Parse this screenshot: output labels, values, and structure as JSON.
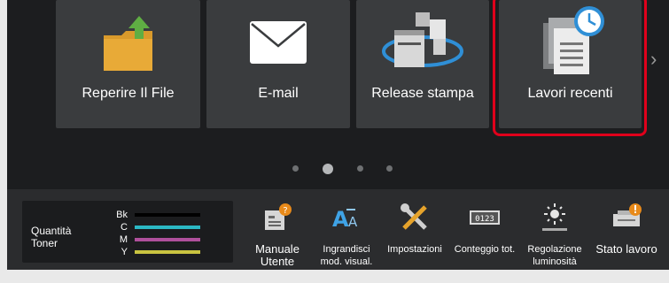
{
  "tiles": [
    {
      "label": "Reperire Il File",
      "icon": "folder-upload-icon"
    },
    {
      "label": "E-mail",
      "icon": "envelope-icon"
    },
    {
      "label": "Release stampa",
      "icon": "printer-network-icon"
    },
    {
      "label": "Lavori recenti",
      "icon": "recent-jobs-clock-icon"
    }
  ],
  "next_arrow": "›",
  "pager": {
    "pages": 4,
    "current": 2
  },
  "toner": {
    "title": "Quantità Toner",
    "levels": [
      {
        "name": "Bk",
        "color": "#000000"
      },
      {
        "name": "C",
        "color": "#2bb8c4"
      },
      {
        "name": "M",
        "color": "#b0509c"
      },
      {
        "name": "Y",
        "color": "#c9c340"
      }
    ]
  },
  "bottom_buttons": [
    {
      "label": "Manuale Utente",
      "icon": "manual-help-icon"
    },
    {
      "label": "Ingrandisci mod. visual.",
      "icon": "enlarge-text-icon"
    },
    {
      "label": "Impostazioni",
      "icon": "settings-tools-icon"
    },
    {
      "label": "Conteggio tot.",
      "icon": "counter-icon"
    },
    {
      "label": "Regolazione luminosità",
      "icon": "brightness-icon"
    },
    {
      "label": "Stato lavoro",
      "icon": "job-status-icon"
    }
  ],
  "colors": {
    "highlight": "#e0001b",
    "tile_bg": "#3a3c3e",
    "panel_bg": "#1c1d1f"
  }
}
